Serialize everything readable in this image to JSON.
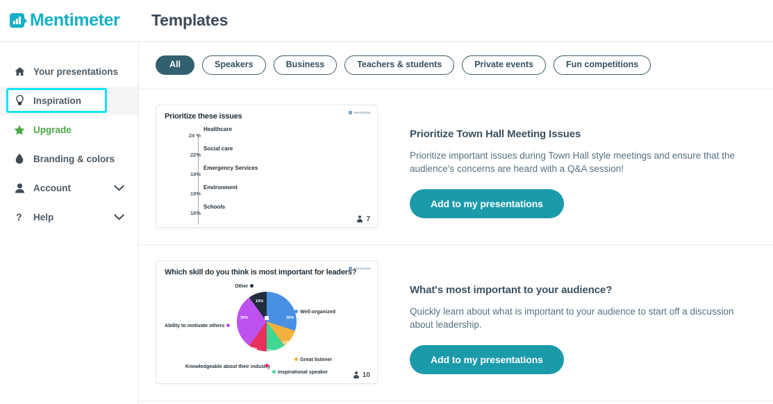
{
  "brand": {
    "name": "Mentimeter",
    "icon": "bar-chart-logo-icon",
    "color": "#14b0c4"
  },
  "header": {
    "title": "Templates"
  },
  "sidebar": {
    "items": [
      {
        "label": "Your presentations",
        "icon": "home-icon",
        "active": false
      },
      {
        "label": "Inspiration",
        "icon": "lightbulb-icon",
        "active": true
      },
      {
        "label": "Upgrade",
        "icon": "star-icon",
        "active": false
      },
      {
        "label": "Branding & colors",
        "icon": "droplet-icon",
        "active": false
      },
      {
        "label": "Account",
        "icon": "user-icon",
        "active": false,
        "chevron": true
      },
      {
        "label": "Help",
        "icon": "question-mark-icon",
        "active": false,
        "chevron": true
      }
    ]
  },
  "filters": {
    "chips": [
      {
        "label": "All",
        "selected": true
      },
      {
        "label": "Speakers",
        "selected": false
      },
      {
        "label": "Business",
        "selected": false
      },
      {
        "label": "Teachers & students",
        "selected": false
      },
      {
        "label": "Private events",
        "selected": false
      },
      {
        "label": "Fun competitions",
        "selected": false
      }
    ]
  },
  "templates": [
    {
      "name": "Prioritize Town Hall Meeting Issues",
      "description": "Prioritize important issues during Town Hall style meetings and ensure that the audience's concerns are heard with a Q&A session!",
      "cta": "Add to my presentations",
      "card": {
        "title": "Prioritize these issues",
        "watermark": "Mentimeter",
        "participants": "7"
      }
    },
    {
      "name": "What's most important to your audience?",
      "description": "Quickly learn about what is important to your audience to start off a discussion about leadership.",
      "cta": "Add to my presentations",
      "card": {
        "title": "Which skill do you think is most important for leaders?",
        "watermark": "Mentimeter",
        "participants": "10"
      }
    }
  ],
  "chart_data": [
    {
      "type": "bar",
      "title": "Prioritize these issues",
      "orientation": "horizontal",
      "categories": [
        "Healthcare",
        "Social care",
        "Emergency Services",
        "Environment",
        "Schools"
      ],
      "values": [
        24,
        22,
        19,
        19,
        16
      ],
      "value_labels": [
        "24 %",
        "22%",
        "19%",
        "19%",
        "16%"
      ],
      "colors": [
        "#4285e8",
        "#efb73e",
        "#3ed894",
        "#e8305e",
        "#b45ee8"
      ],
      "xlabel": "",
      "ylabel": "",
      "xlim": [
        0,
        26
      ],
      "grid": false,
      "legend": false
    },
    {
      "type": "pie",
      "title": "Which skill do you think is most important for leaders?",
      "categories": [
        "Well-organized",
        "Great listener",
        "Inspirational speaker",
        "Knowledgeable about their industry",
        "Ability to motivate others",
        "Other"
      ],
      "values": [
        30,
        10,
        10,
        10,
        30,
        10
      ],
      "value_labels": [
        "30%",
        "10%",
        "10%",
        "10%",
        "30%",
        "10%"
      ],
      "colors": [
        "#4a90e2",
        "#f2b23e",
        "#3ed894",
        "#e8305e",
        "#bd52ef",
        "#1f2d3d"
      ],
      "legend": true,
      "legend_position": "around"
    }
  ]
}
